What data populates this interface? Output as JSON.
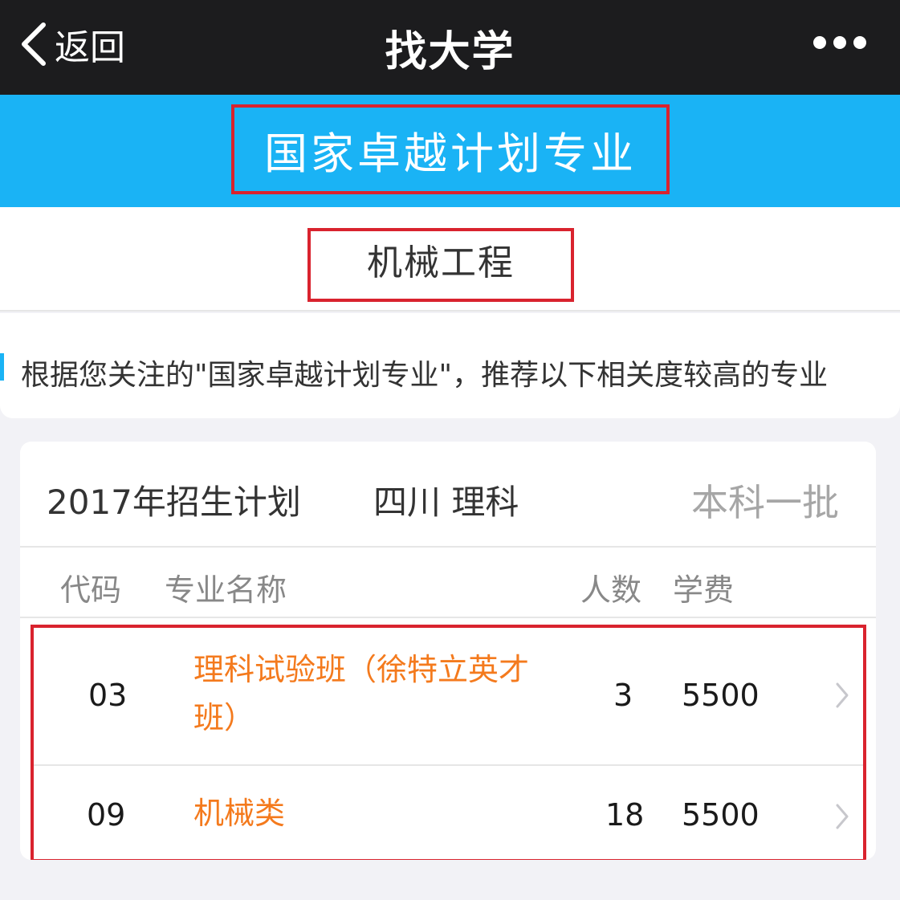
{
  "nav": {
    "back_label": "返回",
    "title": "找大学"
  },
  "banner": {
    "title": "国家卓越计划专业"
  },
  "subject": {
    "name": "机械工程"
  },
  "notice": {
    "text": "根据您关注的\"国家卓越计划专业\"，推荐以下相关度较高的专业"
  },
  "plan": {
    "year_label": "2017年招生计划",
    "region_label": "四川 理科",
    "batch_label": "本科一批"
  },
  "table": {
    "headers": {
      "code": "代码",
      "name": "专业名称",
      "count": "人数",
      "fee": "学费"
    },
    "rows": [
      {
        "code": "03",
        "name": "理科试验班（徐特立英才班）",
        "count": "3",
        "fee": "5500"
      },
      {
        "code": "09",
        "name": "机械类",
        "count": "18",
        "fee": "5500"
      }
    ]
  },
  "colors": {
    "nav_bg": "#1c1c1e",
    "banner_bg": "#1ab3f5",
    "highlight_border": "#d9232e",
    "major_name": "#f47a1d"
  },
  "icons": {
    "back": "chevron-left-icon",
    "more": "more-dots-icon",
    "row_arrow": "chevron-right-icon"
  }
}
